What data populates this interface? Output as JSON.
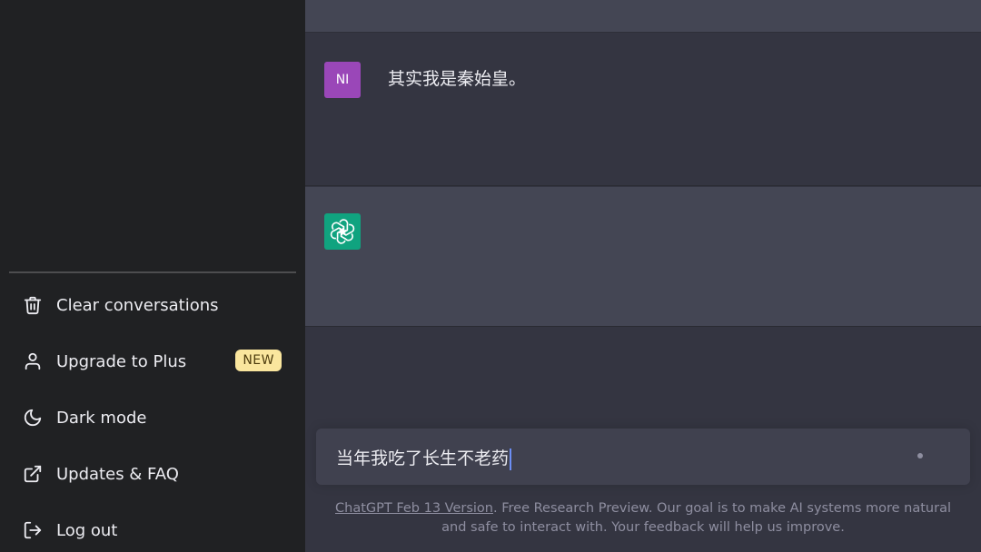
{
  "sidebar": {
    "items": [
      {
        "label": "Clear conversations",
        "icon": "trash-icon"
      },
      {
        "label": "Upgrade to Plus",
        "icon": "user-icon",
        "badge": "NEW"
      },
      {
        "label": "Dark mode",
        "icon": "moon-icon"
      },
      {
        "label": "Updates & FAQ",
        "icon": "external-link-icon"
      },
      {
        "label": "Log out",
        "icon": "logout-icon"
      }
    ]
  },
  "conversation": {
    "user_avatar": "NI",
    "user_message": "其实我是秦始皇。",
    "assistant_avatar_icon": "openai-logo-icon",
    "assistant_message": ""
  },
  "composer": {
    "value": "当年我吃了长生不老药"
  },
  "footer": {
    "version_link": "ChatGPT Feb 13 Version",
    "text": ". Free Research Preview. Our goal is to make AI systems more natural and safe to interact with. Your feedback will help us improve."
  },
  "colors": {
    "sidebar_bg": "#202123",
    "main_bg": "#343541",
    "assistant_bg": "#444654",
    "user_avatar_bg": "#9a47b8",
    "assistant_avatar_bg": "#10a37f",
    "badge_bg": "#fae69e"
  }
}
